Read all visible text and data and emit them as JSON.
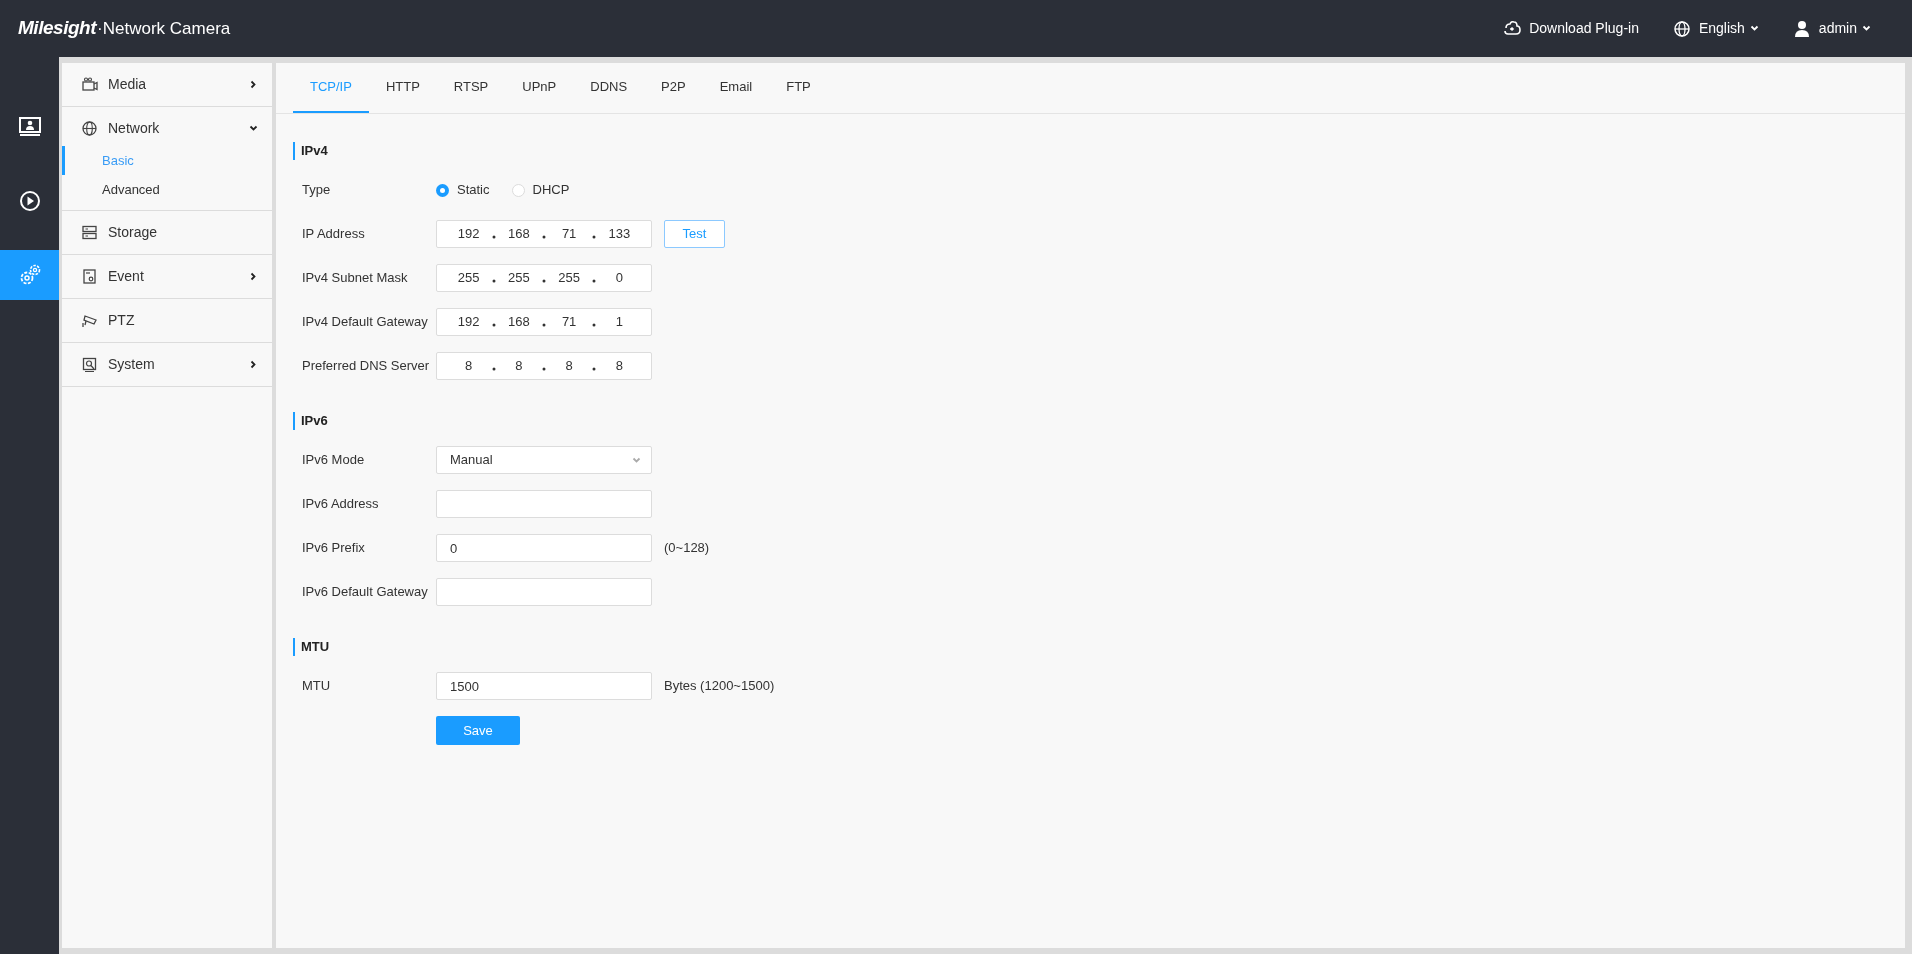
{
  "header": {
    "brand": "Milesight",
    "product": "·Network Camera",
    "actions": [
      {
        "kind": "plugin",
        "label": "Download Plug-in",
        "dropdown": false
      },
      {
        "kind": "language",
        "label": "English",
        "dropdown": true
      },
      {
        "kind": "user",
        "label": "admin",
        "dropdown": true
      }
    ]
  },
  "rail": [
    {
      "kind": "live",
      "selected": false
    },
    {
      "kind": "playback",
      "selected": false
    },
    {
      "kind": "settings",
      "selected": true
    }
  ],
  "menu": [
    {
      "kind": "media",
      "label": "Media",
      "has_submenu": true,
      "expanded": false
    },
    {
      "kind": "network",
      "label": "Network",
      "has_submenu": true,
      "expanded": true,
      "children": [
        {
          "label": "Basic",
          "selected": true
        },
        {
          "label": "Advanced",
          "selected": false
        }
      ]
    },
    {
      "kind": "storage",
      "label": "Storage",
      "has_submenu": false,
      "expanded": false
    },
    {
      "kind": "event",
      "label": "Event",
      "has_submenu": true,
      "expanded": false
    },
    {
      "kind": "ptz",
      "label": "PTZ",
      "has_submenu": false,
      "expanded": false
    },
    {
      "kind": "system",
      "label": "System",
      "has_submenu": true,
      "expanded": false
    }
  ],
  "tabs": [
    {
      "label": "TCP/IP",
      "selected": true
    },
    {
      "label": "HTTP",
      "selected": false
    },
    {
      "label": "RTSP",
      "selected": false
    },
    {
      "label": "UPnP",
      "selected": false
    },
    {
      "label": "DDNS",
      "selected": false
    },
    {
      "label": "P2P",
      "selected": false
    },
    {
      "label": "Email",
      "selected": false
    },
    {
      "label": "FTP",
      "selected": false
    }
  ],
  "sections": [
    {
      "title": "IPv4",
      "rows": [
        {
          "kind": "radio",
          "label": "Type",
          "options": [
            {
              "label": "Static",
              "selected": true
            },
            {
              "label": "DHCP",
              "selected": false
            }
          ]
        },
        {
          "kind": "ip",
          "label": "IP Address",
          "octets": [
            "192",
            "168",
            "71",
            "133"
          ],
          "button": "Test"
        },
        {
          "kind": "ip",
          "label": "IPv4 Subnet Mask",
          "octets": [
            "255",
            "255",
            "255",
            "0"
          ]
        },
        {
          "kind": "ip",
          "label": "IPv4 Default Gateway",
          "octets": [
            "192",
            "168",
            "71",
            "1"
          ]
        },
        {
          "kind": "ip",
          "label": "Preferred DNS Server",
          "octets": [
            "8",
            "8",
            "8",
            "8"
          ]
        }
      ]
    },
    {
      "title": "IPv6",
      "rows": [
        {
          "kind": "select",
          "label": "IPv6 Mode",
          "value": "Manual"
        },
        {
          "kind": "text",
          "label": "IPv6 Address"
        },
        {
          "kind": "text",
          "label": "IPv6 Prefix",
          "value": "0",
          "note": "(0~128)"
        },
        {
          "kind": "text",
          "label": "IPv6 Default Gateway"
        }
      ]
    },
    {
      "title": "MTU",
      "rows": [
        {
          "kind": "text",
          "label": "MTU",
          "value": "1500",
          "note": "Bytes (1200~1500)"
        }
      ]
    }
  ],
  "save_button": "Save"
}
